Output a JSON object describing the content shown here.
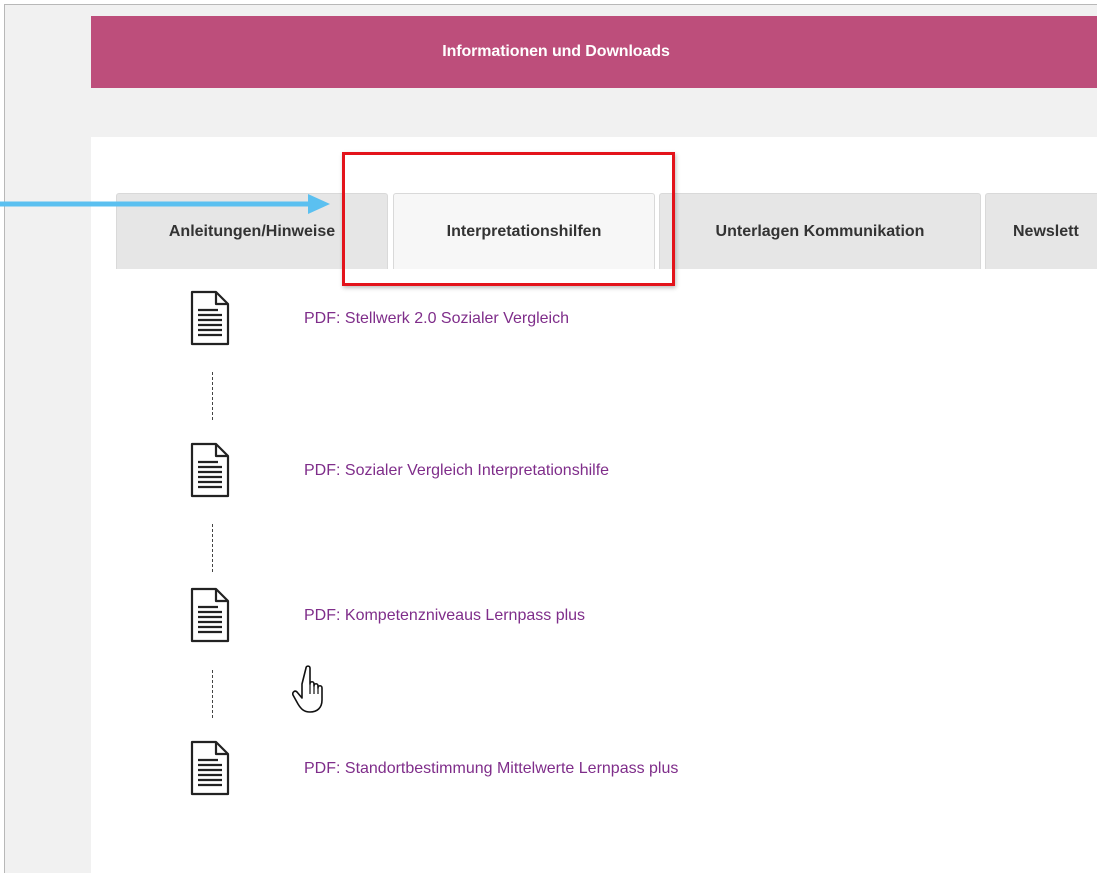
{
  "banner": {
    "title": "Informationen und Downloads"
  },
  "tabs": [
    {
      "label": "Anleitungen/Hinweise",
      "active": false
    },
    {
      "label": "Interpretationshilfen",
      "active": true
    },
    {
      "label": "Unterlagen Kommunikation",
      "active": false
    },
    {
      "label": "Newslett",
      "active": false
    }
  ],
  "documents": [
    {
      "label": "PDF: Stellwerk 2.0 Sozialer Vergleich",
      "icon": "document-icon"
    },
    {
      "label": "PDF: Sozialer Vergleich Interpretationshilfe",
      "icon": "document-icon"
    },
    {
      "label": "PDF: Kompetenzniveaus Lernpass plus",
      "icon": "document-icon"
    },
    {
      "label": "PDF: Standortbestimmung Mittelwerte Lernpass plus",
      "icon": "document-icon"
    }
  ],
  "colors": {
    "banner": "#bd4e7b",
    "link": "#7f2d8a",
    "highlight_box": "#e3131b",
    "arrow": "#5bc0f0"
  }
}
